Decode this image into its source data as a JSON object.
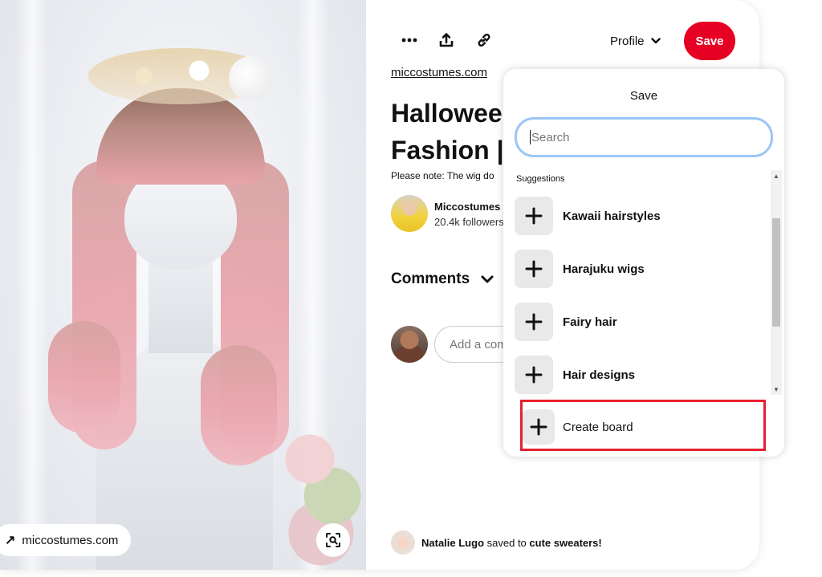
{
  "pin": {
    "source_domain": "miccostumes.com",
    "source_link": "miccostumes.com",
    "title": "Hallowee\nFashion |",
    "description": "Please note: The wig do",
    "creator": {
      "name": "Miccostumes",
      "followers": "20.4k followers"
    }
  },
  "toolbar": {
    "more_icon": "more-icon",
    "share_icon": "share-icon",
    "link_icon": "link-icon",
    "profile_label": "Profile",
    "save_label": "Save"
  },
  "comments": {
    "heading": "Comments",
    "input_placeholder": "Add a com"
  },
  "activity": {
    "user": "Natalie Lugo",
    "verb": "saved to",
    "board": "cute sweaters!"
  },
  "save_popover": {
    "title": "Save",
    "search_placeholder": "Search",
    "suggestions_label": "Suggestions",
    "boards": [
      {
        "name": "Kawaii hairstyles"
      },
      {
        "name": "Harajuku wigs"
      },
      {
        "name": "Fairy hair"
      },
      {
        "name": "Hair designs"
      }
    ],
    "create_board_label": "Create board"
  },
  "colors": {
    "save_button": "#e60023",
    "search_focus_ring": "#9cc6f7",
    "highlight": "#e5202e"
  }
}
